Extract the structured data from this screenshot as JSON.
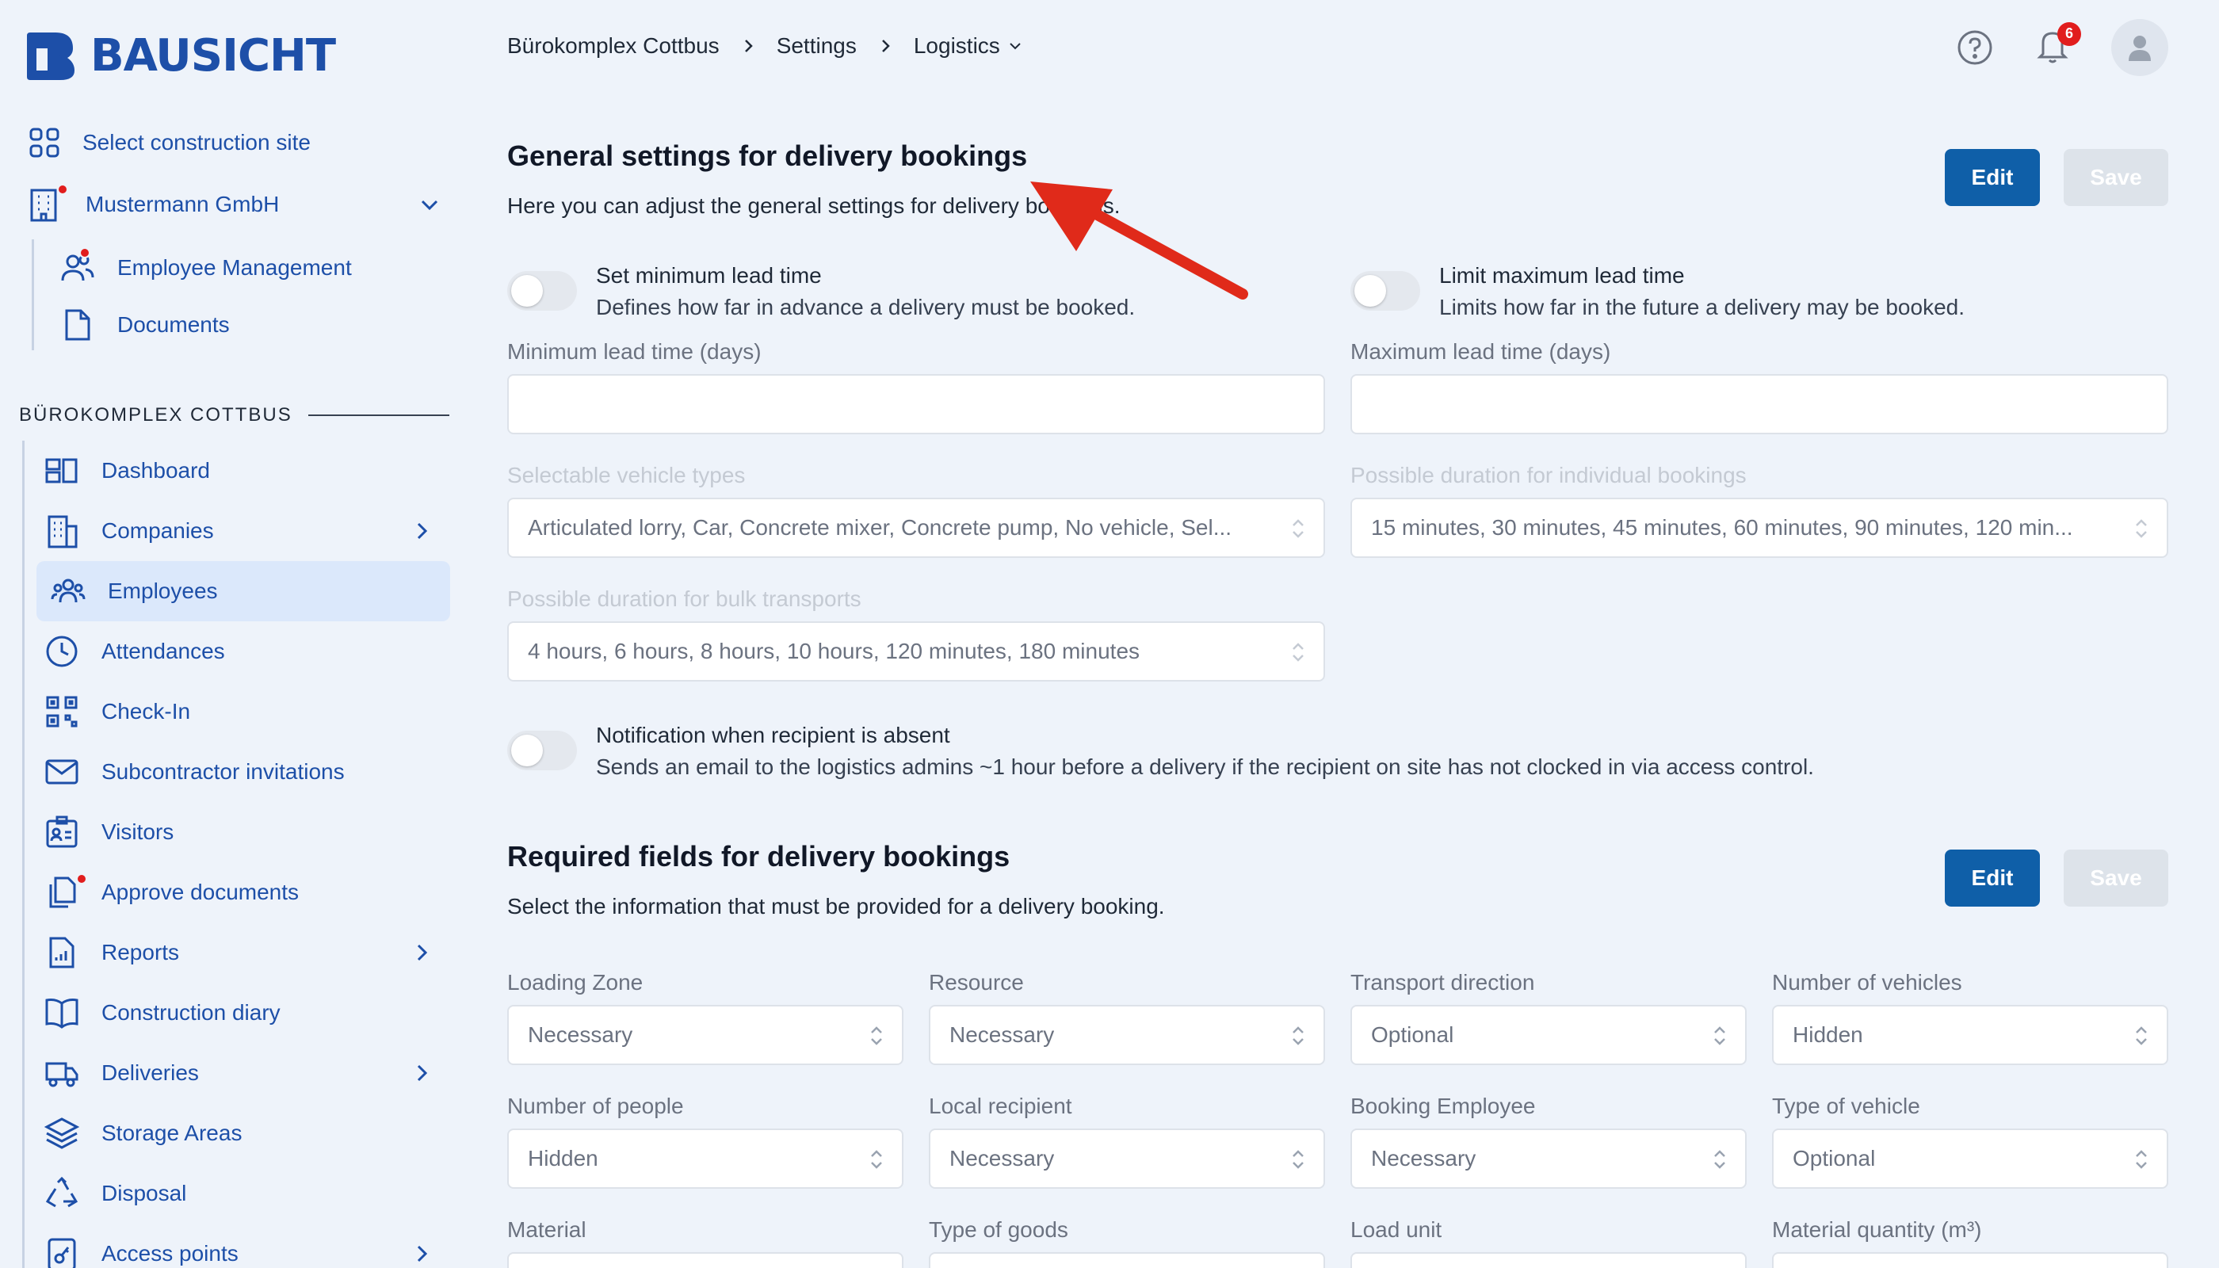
{
  "app": {
    "logo_text": "BAUSICHT"
  },
  "sidebar": {
    "select_site": "Select construction site",
    "company": "Mustermann GmbH",
    "company_children": [
      {
        "label": "Employee Management"
      },
      {
        "label": "Documents"
      }
    ],
    "section_title": "BÜROKOMPLEX COTTBUS",
    "items": [
      {
        "label": "Dashboard"
      },
      {
        "label": "Companies"
      },
      {
        "label": "Employees"
      },
      {
        "label": "Attendances"
      },
      {
        "label": "Check-In"
      },
      {
        "label": "Subcontractor invitations"
      },
      {
        "label": "Visitors"
      },
      {
        "label": "Approve documents"
      },
      {
        "label": "Reports"
      },
      {
        "label": "Construction diary"
      },
      {
        "label": "Deliveries"
      },
      {
        "label": "Storage Areas"
      },
      {
        "label": "Disposal"
      },
      {
        "label": "Access points"
      }
    ],
    "active_item": "Employees"
  },
  "header": {
    "breadcrumb": [
      "Bürokomplex Cottbus",
      "Settings",
      "Logistics"
    ],
    "notification_count": "6"
  },
  "general": {
    "title": "General settings for delivery bookings",
    "description": "Here you can adjust the general settings for delivery bookings.",
    "edit_label": "Edit",
    "save_label": "Save",
    "min_lead": {
      "title": "Set minimum lead time",
      "desc": "Defines how far in advance a delivery must be booked.",
      "enabled": false
    },
    "max_lead": {
      "title": "Limit maximum lead time",
      "desc": "Limits how far in the future a delivery may be booked.",
      "enabled": false
    },
    "min_days_label": "Minimum lead time (days)",
    "max_days_label": "Maximum lead time (days)",
    "vehicle_types_label": "Selectable vehicle types",
    "vehicle_types_value": "Articulated lorry, Car, Concrete mixer, Concrete pump, No vehicle, Sel...",
    "duration_individual_label": "Possible duration for individual bookings",
    "duration_individual_value": "15 minutes, 30 minutes, 45 minutes, 60 minutes, 90 minutes, 120 min...",
    "duration_bulk_label": "Possible duration for bulk transports",
    "duration_bulk_value": "4 hours, 6 hours, 8 hours, 10 hours, 120 minutes, 180 minutes",
    "absent": {
      "title": "Notification when recipient is absent",
      "desc": "Sends an email to the logistics admins ~1 hour before a delivery if the recipient on site has not clocked in via access control.",
      "enabled": false
    }
  },
  "required": {
    "title": "Required fields for delivery bookings",
    "description": "Select the information that must be provided for a delivery booking.",
    "edit_label": "Edit",
    "save_label": "Save",
    "fields": [
      {
        "label": "Loading Zone",
        "value": "Necessary"
      },
      {
        "label": "Resource",
        "value": "Necessary"
      },
      {
        "label": "Transport direction",
        "value": "Optional"
      },
      {
        "label": "Number of vehicles",
        "value": "Hidden"
      },
      {
        "label": "Number of people",
        "value": "Hidden"
      },
      {
        "label": "Local recipient",
        "value": "Necessary"
      },
      {
        "label": "Booking Employee",
        "value": "Necessary"
      },
      {
        "label": "Type of vehicle",
        "value": "Optional"
      },
      {
        "label": "Material",
        "value": ""
      },
      {
        "label": "Type of goods",
        "value": ""
      },
      {
        "label": "Load unit",
        "value": ""
      },
      {
        "label": "Material quantity (m³)",
        "value": ""
      }
    ]
  },
  "colors": {
    "brand": "#1d4fa8",
    "primary_button": "#0f5fa8",
    "alert": "#e11d1d",
    "annotation_arrow": "#e02a1a"
  }
}
